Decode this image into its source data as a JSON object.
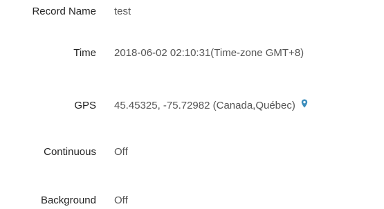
{
  "record": {
    "name_label": "Record Name",
    "name_value": "test",
    "time_label": "Time",
    "time_value": "2018-06-02 02:10:31(Time-zone GMT+8)",
    "gps_label": "GPS",
    "gps_value": "45.45325, -75.72982 (Canada,Québec)",
    "continuous_label": "Continuous",
    "continuous_value": "Off",
    "background_label": "Background",
    "background_value": "Off"
  },
  "icons": {
    "gps_icon": "map-pin-icon"
  },
  "colors": {
    "label": "#222222",
    "value": "#555555",
    "pin": "#3c8dbc"
  }
}
